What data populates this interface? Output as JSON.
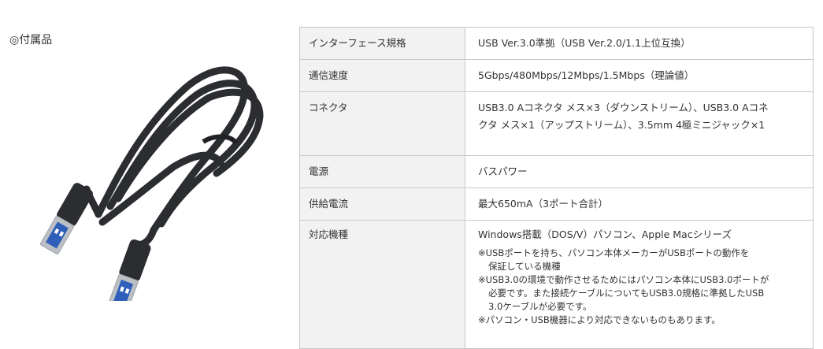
{
  "accessory_label": "◎付属品",
  "image": {
    "subject": "usb-cable",
    "cable_color": "#2b2d30",
    "connector_color": "#bcc0c4",
    "tongue_color": "#2f5fb8"
  },
  "specs": [
    {
      "key": "インターフェース規格",
      "value": "USB Ver.3.0準拠（USB Ver.2.0/1.1上位互換）"
    },
    {
      "key": "通信速度",
      "value": "5Gbps/480Mbps/12Mbps/1.5Mbps（理論値）"
    },
    {
      "key": "コネクタ",
      "value_lines": [
        "USB3.0 Aコネクタ メス×3（ダウンストリーム）、USB3.0 Aコネ",
        "クタ メス×1（アップストリーム）、3.5mm 4極ミニジャック×1"
      ]
    },
    {
      "key": "電源",
      "value": "バスパワー"
    },
    {
      "key": "供給電流",
      "value": "最大650mA（3ポート合計）"
    },
    {
      "key": "対応機種",
      "value": "Windows搭載（DOS/V）パソコン、Apple Macシリーズ",
      "notes": [
        [
          "※USBポートを持ち、パソコン本体メーカーがUSBポートの動作を",
          "保証している機種"
        ],
        [
          "※USB3.0の環境で動作させるためにはパソコン本体にUSB3.0ポートが",
          "必要です。また接続ケーブルについてもUSB3.0規格に準拠したUSB",
          "3.0ケーブルが必要です。"
        ],
        [
          "※パソコン・USB機器により対応できないものもあります。"
        ]
      ]
    }
  ]
}
